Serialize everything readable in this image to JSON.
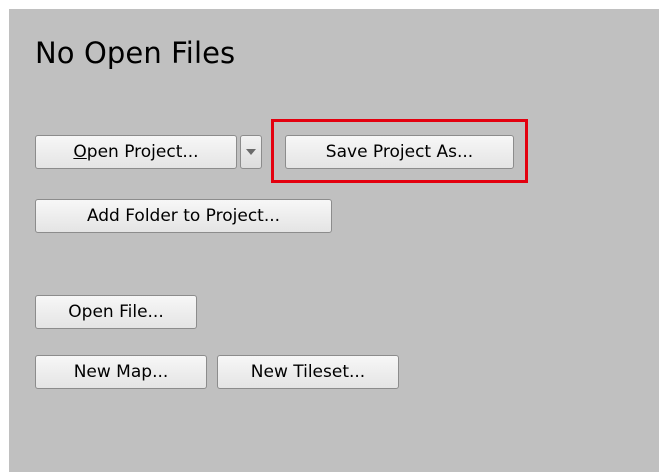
{
  "page": {
    "title": "No Open Files"
  },
  "buttons": {
    "open_project": {
      "mnemonic": "O",
      "rest": "pen Project..."
    },
    "open_project_menu_icon": "chevron-down-icon",
    "save_project_as": "Save Project As...",
    "add_folder": "Add Folder to Project...",
    "open_file": "Open File...",
    "new_map": "New Map...",
    "new_tileset": "New Tileset..."
  },
  "colors": {
    "panel_background": "#c0c0c0",
    "highlight_border": "#e3000f"
  }
}
